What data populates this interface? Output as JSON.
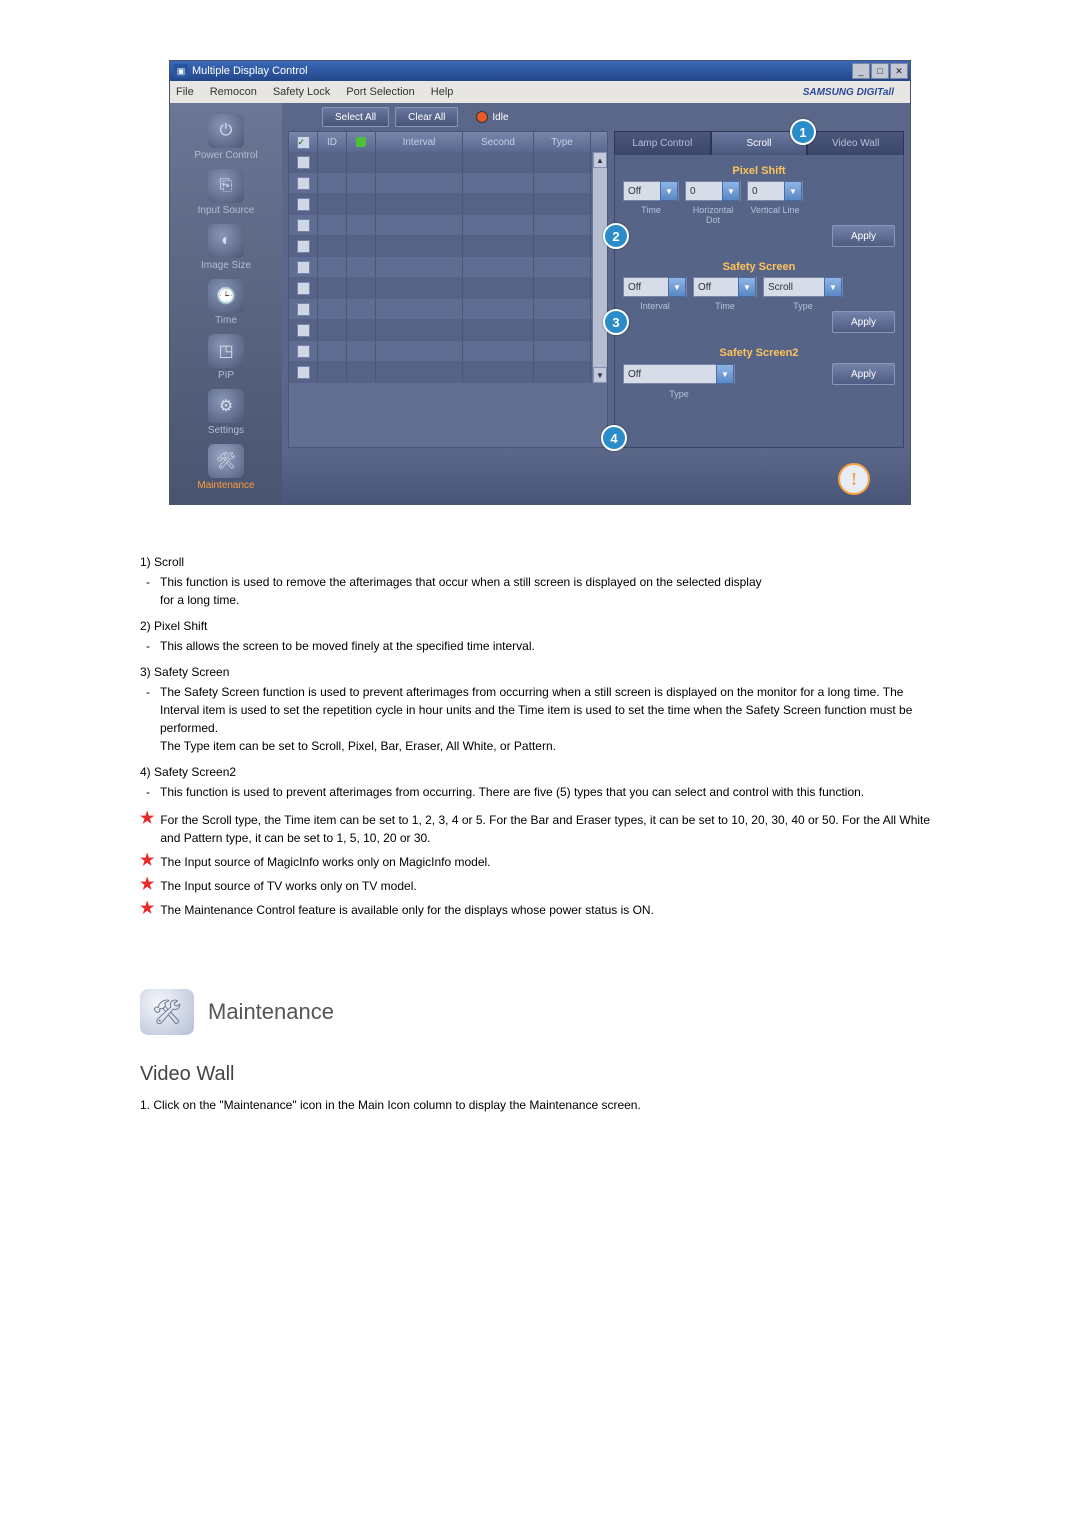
{
  "app": {
    "title": "Multiple Display Control",
    "menu": {
      "file": "File",
      "remocon": "Remocon",
      "safety": "Safety Lock",
      "port": "Port Selection",
      "help": "Help"
    },
    "brand": "SAMSUNG DIGITall",
    "toolbar": {
      "select_all": "Select All",
      "clear_all": "Clear All",
      "idle": "Idle"
    },
    "sidebar": {
      "items": [
        {
          "label": "Power Control"
        },
        {
          "label": "Input Source"
        },
        {
          "label": "Image Size"
        },
        {
          "label": "Time"
        },
        {
          "label": "PIP"
        },
        {
          "label": "Settings"
        },
        {
          "label": "Maintenance"
        }
      ]
    },
    "list": {
      "headers": {
        "id": "ID",
        "interval": "Interval",
        "second": "Second",
        "type": "Type"
      }
    },
    "tabs": {
      "lamp": "Lamp Control",
      "scroll": "Scroll",
      "video": "Video Wall"
    },
    "pixel_shift": {
      "title": "Pixel Shift",
      "time": "Off",
      "hdot": "0",
      "vline": "0",
      "labels": {
        "time": "Time",
        "hdot": "Horizontal Dot",
        "vline": "Vertical Line"
      },
      "apply": "Apply"
    },
    "safety_screen": {
      "title": "Safety Screen",
      "interval": "Off",
      "time": "Off",
      "type": "Scroll",
      "labels": {
        "interval": "Interval",
        "time": "Time",
        "type": "Type"
      },
      "apply": "Apply"
    },
    "safety_screen2": {
      "title": "Safety Screen2",
      "type": "Off",
      "labels": {
        "type": "Type"
      },
      "apply": "Apply"
    },
    "callouts": {
      "c1": "1",
      "c2": "2",
      "c3": "3",
      "c4": "4"
    }
  },
  "doc": {
    "items": [
      {
        "num": "1)",
        "title": "Scroll",
        "body": "This function is used to remove the afterimages that occur when a still screen is displayed on the selected display\nfor a long time."
      },
      {
        "num": "2)",
        "title": "Pixel Shift",
        "body": "This allows the screen to be moved finely at the specified time interval."
      },
      {
        "num": "3)",
        "title": "Safety Screen",
        "body": "The Safety Screen function is used to prevent afterimages from occurring when a still screen is displayed on the monitor for a long time.  The Interval item is used to set the repetition cycle in hour units and the Time item is used to set the time when the Safety Screen function must be performed.\nThe Type item can be set to Scroll, Pixel, Bar, Eraser, All White, or Pattern."
      },
      {
        "num": "4)",
        "title": "Safety Screen2",
        "body": "This function is used to prevent afterimages from occurring. There are five (5) types that you can select and control with this function."
      }
    ],
    "notes": [
      "For the Scroll type, the Time item can be set to 1, 2, 3, 4 or 5. For the Bar and Eraser types, it can be set to 10, 20, 30, 40 or 50. For the All White and Pattern type, it can be set to 1, 5, 10, 20 or 30.",
      "The Input source of MagicInfo works only on MagicInfo model.",
      "The Input source of TV works only on TV model.",
      "The Maintenance Control feature is available only for the displays whose power status is ON."
    ],
    "section_title": "Maintenance",
    "subheading": "Video Wall",
    "step1": "Click on the \"Maintenance\" icon in the Main Icon column to display the Maintenance screen."
  }
}
